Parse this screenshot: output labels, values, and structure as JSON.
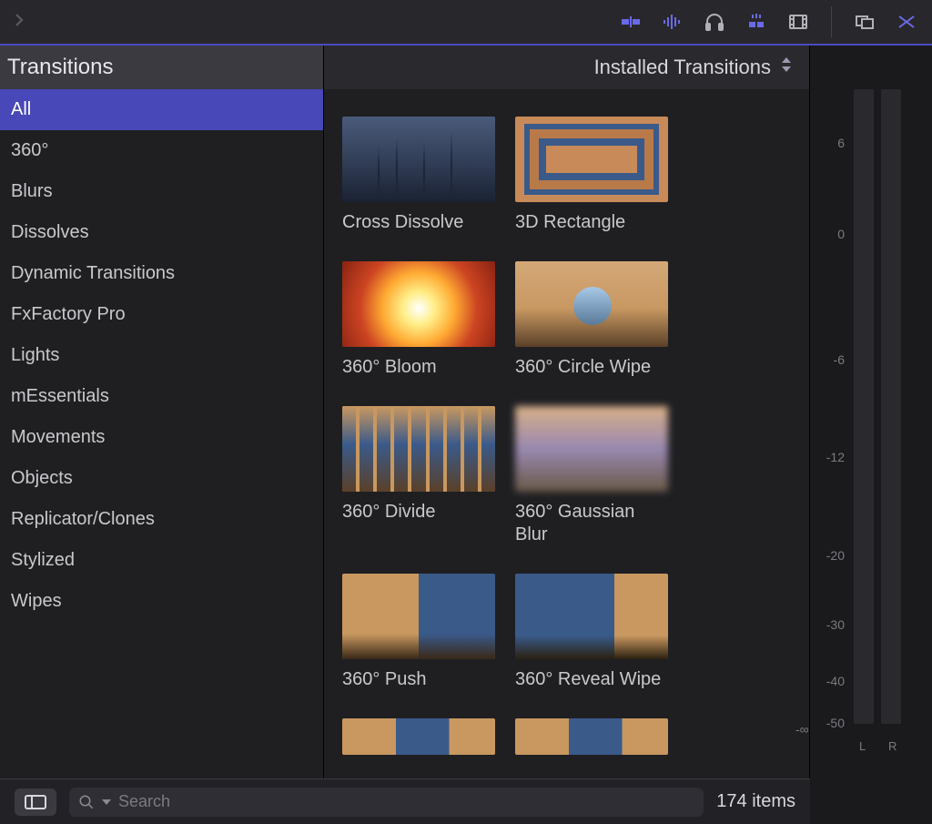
{
  "sidebar": {
    "title": "Transitions",
    "items": [
      {
        "label": "All",
        "selected": true
      },
      {
        "label": "360°",
        "selected": false
      },
      {
        "label": "Blurs",
        "selected": false
      },
      {
        "label": "Dissolves",
        "selected": false
      },
      {
        "label": "Dynamic Transitions",
        "selected": false
      },
      {
        "label": "FxFactory Pro",
        "selected": false
      },
      {
        "label": "Lights",
        "selected": false
      },
      {
        "label": "mEssentials",
        "selected": false
      },
      {
        "label": "Movements",
        "selected": false
      },
      {
        "label": "Objects",
        "selected": false
      },
      {
        "label": "Replicator/Clones",
        "selected": false
      },
      {
        "label": "Stylized",
        "selected": false
      },
      {
        "label": "Wipes",
        "selected": false
      }
    ]
  },
  "content": {
    "dropdown_label": "Installed Transitions",
    "items": [
      {
        "label": "Cross Dissolve",
        "thumb": "th-crossdissolve"
      },
      {
        "label": "3D Rectangle",
        "thumb": "th-3drect"
      },
      {
        "label": "360° Bloom",
        "thumb": "th-360bloom"
      },
      {
        "label": "360° Circle Wipe",
        "thumb": "th-360circle"
      },
      {
        "label": "360° Divide",
        "thumb": "th-360divide"
      },
      {
        "label": "360° Gaussian Blur",
        "thumb": "th-360gauss"
      },
      {
        "label": "360° Push",
        "thumb": "th-360push"
      },
      {
        "label": "360° Reveal Wipe",
        "thumb": "th-360reveal"
      },
      {
        "label": "",
        "thumb": "th-partial"
      },
      {
        "label": "",
        "thumb": "th-partial"
      }
    ]
  },
  "meters": {
    "ticks": [
      "6",
      "0",
      "-6",
      "-12",
      "-20",
      "-30",
      "-40",
      "-50"
    ],
    "tick_positions": [
      9,
      22,
      40,
      54,
      68,
      78,
      86,
      92
    ],
    "inf_label": "-∞",
    "l_label": "L",
    "r_label": "R"
  },
  "bottombar": {
    "search_placeholder": "Search",
    "item_count": "174 items"
  },
  "toolbar_icons": [
    "clip-trim",
    "audio-waveform",
    "headphones",
    "effects",
    "film",
    "compare",
    "share"
  ]
}
